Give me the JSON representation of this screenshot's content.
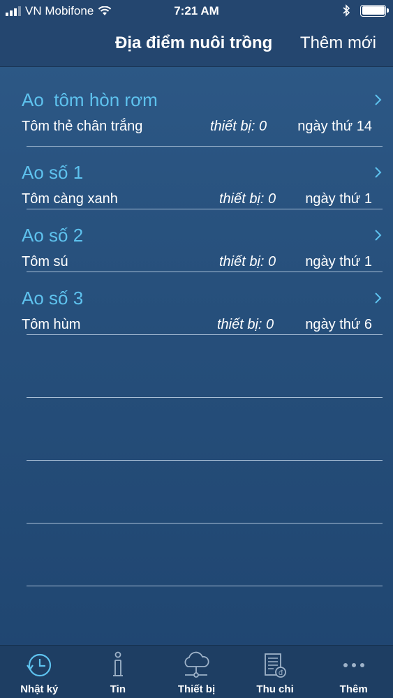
{
  "status_bar": {
    "carrier": "VN Mobifone",
    "time": "7:21 AM"
  },
  "nav": {
    "title": "Địa điểm nuôi trồng",
    "action": "Thêm mới"
  },
  "ponds": [
    {
      "name": "Ao  tôm hòn rơm",
      "species": "Tôm thẻ chân trắng",
      "devices": "thiết bị: 0",
      "day": "ngày thứ 14"
    },
    {
      "name": "Ao số 1",
      "species": "Tôm càng xanh",
      "devices": "thiết bị: 0",
      "day": "ngày thứ 1"
    },
    {
      "name": "Ao số 2",
      "species": "Tôm sú",
      "devices": "thiết bị: 0",
      "day": "ngày thứ 1"
    },
    {
      "name": "Ao số 3",
      "species": "Tôm hùm",
      "devices": "thiết bị: 0",
      "day": "ngày thứ 6"
    }
  ],
  "tabs": [
    {
      "label": "Nhật ký",
      "icon": "clock-icon",
      "active": true
    },
    {
      "label": "Tin",
      "icon": "info-icon",
      "active": false
    },
    {
      "label": "Thiết bị",
      "icon": "cloud-network-icon",
      "active": false
    },
    {
      "label": "Thu chi",
      "icon": "ledger-icon",
      "active": false
    },
    {
      "label": "Thêm",
      "icon": "more-dots-icon",
      "active": false
    }
  ],
  "colors": {
    "accent": "#5ec2ee",
    "background": "#27507c",
    "nav_background": "#24466f",
    "tab_background": "#1e3e63",
    "divider": "#a9bfd6"
  }
}
